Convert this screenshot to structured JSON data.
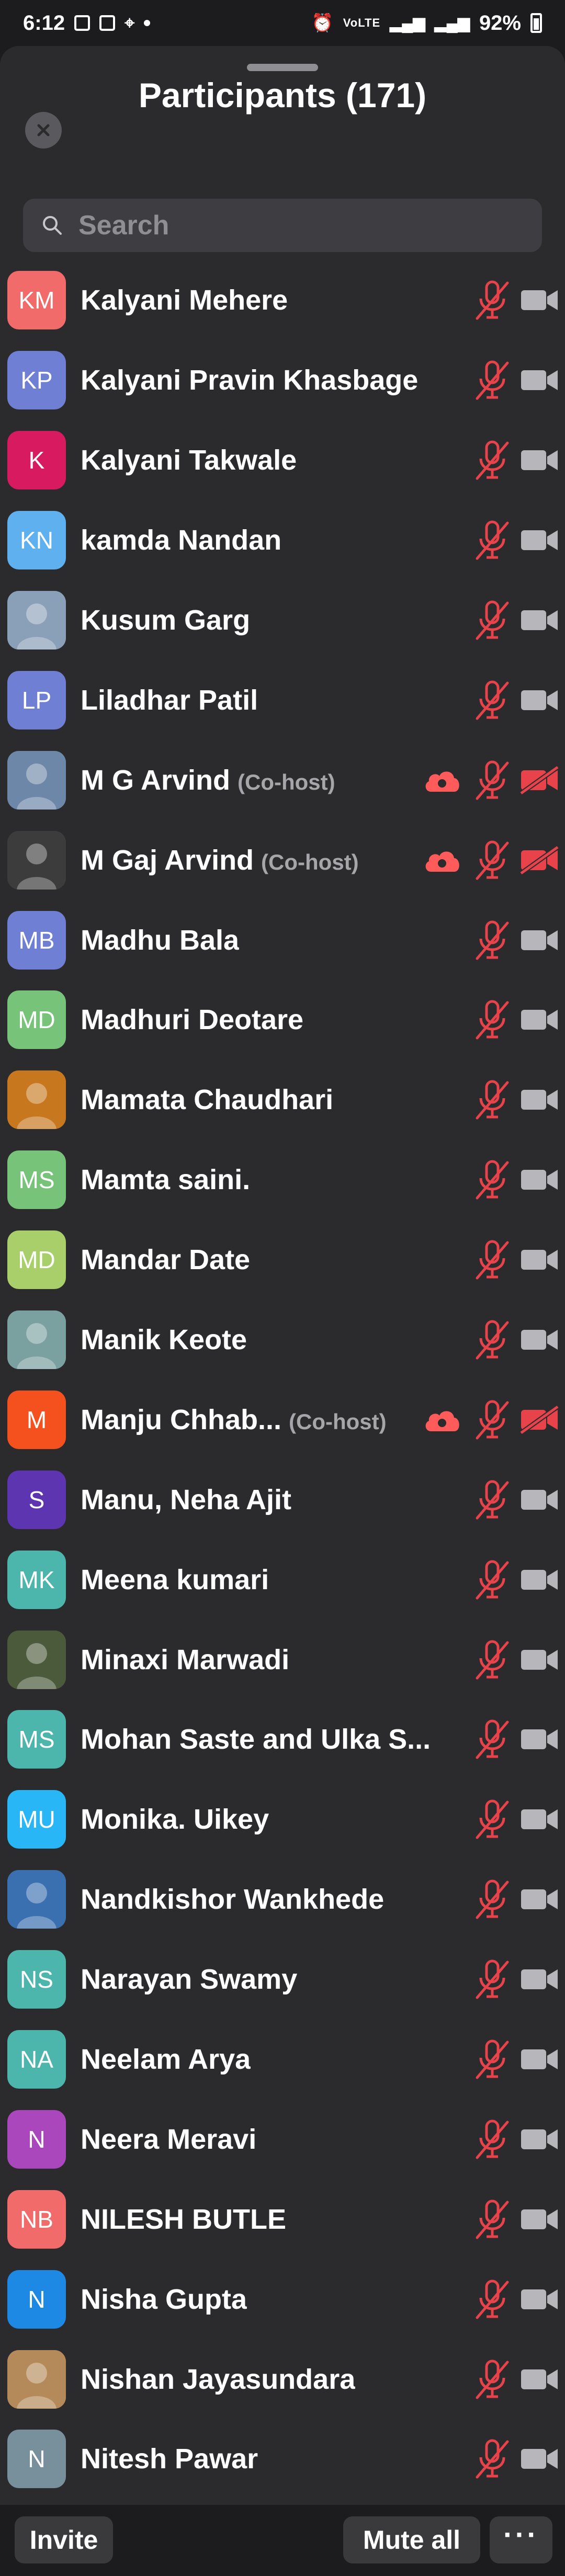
{
  "status_bar": {
    "time": "6:12",
    "network_label": "VoLTE",
    "battery": "92%"
  },
  "sheet": {
    "title": "Participants (171)",
    "search_placeholder": "Search"
  },
  "colors": {
    "mic_muted": "#e8424b",
    "cam_off": "#e8424b",
    "cam_on": "#b7b7bb",
    "cloud": "#ff5b5b"
  },
  "participants": [
    {
      "initials": "KM",
      "name": "Kalyani Mehere",
      "avatar_color": "#f16b6b",
      "role": "",
      "photo": false,
      "camera_off": false,
      "recording": false
    },
    {
      "initials": "KP",
      "name": "Kalyani Pravin Khasbage",
      "avatar_color": "#6f7fd3",
      "role": "",
      "photo": false,
      "camera_off": false,
      "recording": false
    },
    {
      "initials": "K",
      "name": "Kalyani Takwale",
      "avatar_color": "#d81b60",
      "role": "",
      "photo": false,
      "camera_off": false,
      "recording": false
    },
    {
      "initials": "KN",
      "name": "kamda Nandan",
      "avatar_color": "#5fb0ee",
      "role": "",
      "photo": false,
      "camera_off": false,
      "recording": false
    },
    {
      "initials": "",
      "name": "Kusum Garg",
      "avatar_color": "#8aa0b8",
      "role": "",
      "photo": true,
      "camera_off": false,
      "recording": false
    },
    {
      "initials": "LP",
      "name": "Liladhar Patil",
      "avatar_color": "#6f7fd3",
      "role": "",
      "photo": false,
      "camera_off": false,
      "recording": false
    },
    {
      "initials": "",
      "name": "M G Arvind",
      "avatar_color": "#6d87a8",
      "role": "(Co-host)",
      "photo": true,
      "camera_off": true,
      "recording": true
    },
    {
      "initials": "",
      "name": "M Gaj Arvind",
      "avatar_color": "#3c3c3c",
      "role": "(Co-host)",
      "photo": true,
      "camera_off": true,
      "recording": true
    },
    {
      "initials": "MB",
      "name": "Madhu Bala",
      "avatar_color": "#6f7fd3",
      "role": "",
      "photo": false,
      "camera_off": false,
      "recording": false
    },
    {
      "initials": "MD",
      "name": "Madhuri Deotare",
      "avatar_color": "#77c37a",
      "role": "",
      "photo": false,
      "camera_off": false,
      "recording": false
    },
    {
      "initials": "",
      "name": "Mamata Chaudhari",
      "avatar_color": "#c7781f",
      "role": "",
      "photo": true,
      "camera_off": false,
      "recording": false
    },
    {
      "initials": "MS",
      "name": "Mamta saini.",
      "avatar_color": "#77c37a",
      "role": "",
      "photo": false,
      "camera_off": false,
      "recording": false
    },
    {
      "initials": "MD",
      "name": "Mandar Date",
      "avatar_color": "#a8cf6a",
      "role": "",
      "photo": false,
      "camera_off": false,
      "recording": false
    },
    {
      "initials": "",
      "name": "Manik Keote",
      "avatar_color": "#7aa0a0",
      "role": "",
      "photo": true,
      "camera_off": false,
      "recording": false
    },
    {
      "initials": "M",
      "name": "Manju Chhab...",
      "avatar_color": "#f4511e",
      "role": "(Co-host)",
      "photo": false,
      "camera_off": true,
      "recording": true
    },
    {
      "initials": "S",
      "name": "Manu, Neha Ajit",
      "avatar_color": "#5e35b1",
      "role": "",
      "photo": false,
      "camera_off": false,
      "recording": false
    },
    {
      "initials": "MK",
      "name": "Meena kumari",
      "avatar_color": "#4db6ac",
      "role": "",
      "photo": false,
      "camera_off": false,
      "recording": false
    },
    {
      "initials": "",
      "name": "Minaxi Marwadi",
      "avatar_color": "#4a5a3a",
      "role": "",
      "photo": true,
      "camera_off": false,
      "recording": false
    },
    {
      "initials": "MS",
      "name": "Mohan Saste and Ulka S...",
      "avatar_color": "#4db6ac",
      "role": "",
      "photo": false,
      "camera_off": false,
      "recording": false
    },
    {
      "initials": "MU",
      "name": "Monika. Uikey",
      "avatar_color": "#29b6f6",
      "role": "",
      "photo": false,
      "camera_off": false,
      "recording": false
    },
    {
      "initials": "",
      "name": "Nandkishor Wankhede",
      "avatar_color": "#3a6fb0",
      "role": "",
      "photo": true,
      "camera_off": false,
      "recording": false
    },
    {
      "initials": "NS",
      "name": "Narayan Swamy",
      "avatar_color": "#4db6ac",
      "role": "",
      "photo": false,
      "camera_off": false,
      "recording": false
    },
    {
      "initials": "NA",
      "name": "Neelam Arya",
      "avatar_color": "#4db6ac",
      "role": "",
      "photo": false,
      "camera_off": false,
      "recording": false
    },
    {
      "initials": "N",
      "name": "Neera Meravi",
      "avatar_color": "#ab47bc",
      "role": "",
      "photo": false,
      "camera_off": false,
      "recording": false
    },
    {
      "initials": "NB",
      "name": "NILESH BUTLE",
      "avatar_color": "#f16b6b",
      "role": "",
      "photo": false,
      "camera_off": false,
      "recording": false
    },
    {
      "initials": "N",
      "name": "Nisha Gupta",
      "avatar_color": "#1e88e5",
      "role": "",
      "photo": false,
      "camera_off": false,
      "recording": false
    },
    {
      "initials": "",
      "name": "Nishan Jayasundara",
      "avatar_color": "#b48a5a",
      "role": "",
      "photo": true,
      "camera_off": false,
      "recording": false
    },
    {
      "initials": "N",
      "name": "Nitesh Pawar",
      "avatar_color": "#78909c",
      "role": "",
      "photo": false,
      "camera_off": false,
      "recording": false
    }
  ],
  "bottom_bar": {
    "invite_label": "Invite",
    "mute_all_label": "Mute all",
    "more_label": "···"
  }
}
